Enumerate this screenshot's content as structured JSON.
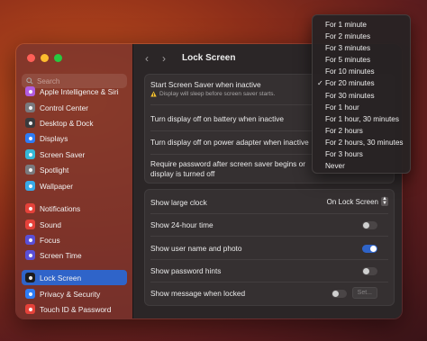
{
  "sidebar": {
    "search_placeholder": "Search",
    "items": [
      {
        "label": "Apple Intelligence & Siri",
        "icon": "apple-intelligence-icon",
        "color": "#b25ce0"
      },
      {
        "label": "Control Center",
        "icon": "control-center-icon",
        "color": "#7a7a7e"
      },
      {
        "label": "Desktop & Dock",
        "icon": "desktop-dock-icon",
        "color": "#3a3a3c"
      },
      {
        "label": "Displays",
        "icon": "displays-icon",
        "color": "#2e7cf6"
      },
      {
        "label": "Screen Saver",
        "icon": "screen-saver-icon",
        "color": "#36b7d6"
      },
      {
        "label": "Spotlight",
        "icon": "spotlight-icon",
        "color": "#7a7a7e"
      },
      {
        "label": "Wallpaper",
        "icon": "wallpaper-icon",
        "color": "#38a9e8"
      },
      {
        "label": "Notifications",
        "icon": "notifications-icon",
        "color": "#e5423a"
      },
      {
        "label": "Sound",
        "icon": "sound-icon",
        "color": "#e5423a"
      },
      {
        "label": "Focus",
        "icon": "focus-icon",
        "color": "#5a4fd6"
      },
      {
        "label": "Screen Time",
        "icon": "screen-time-icon",
        "color": "#5a4fd6"
      },
      {
        "label": "Lock Screen",
        "icon": "lock-screen-icon",
        "color": "#1c1c1e"
      },
      {
        "label": "Privacy & Security",
        "icon": "privacy-hand-icon",
        "color": "#2e7cf6"
      },
      {
        "label": "Touch ID & Password",
        "icon": "touch-id-icon",
        "color": "#e5423a"
      }
    ],
    "active": "Lock Screen"
  },
  "main": {
    "title": "Lock Screen",
    "group1": {
      "screen_saver_label": "Start Screen Saver when inactive",
      "screen_saver_note": "Display will sleep before screen saver starts.",
      "battery_label": "Turn display off on battery when inactive",
      "power_label": "Turn display off on power adapter when inactive",
      "password_label_line1": "Require password after screen saver begins or",
      "password_label_line2": "display is turned off"
    },
    "group2": {
      "large_clock_label": "Show large clock",
      "large_clock_value": "On Lock Screen",
      "hour24_label": "Show 24-hour time",
      "hour24_on": false,
      "username_label": "Show user name and photo",
      "username_on": true,
      "hints_label": "Show password hints",
      "hints_on": false,
      "message_label": "Show message when locked",
      "message_on": false,
      "set_button": "Set..."
    }
  },
  "menu": {
    "items": [
      "For 1 minute",
      "For 2 minutes",
      "For 3 minutes",
      "For 5 minutes",
      "For 10 minutes",
      "For 20 minutes",
      "For 30 minutes",
      "For 1 hour",
      "For 1 hour, 30 minutes",
      "For 2 hours",
      "For 2 hours, 30 minutes",
      "For 3 hours",
      "Never"
    ],
    "selected": "For 20 minutes"
  }
}
